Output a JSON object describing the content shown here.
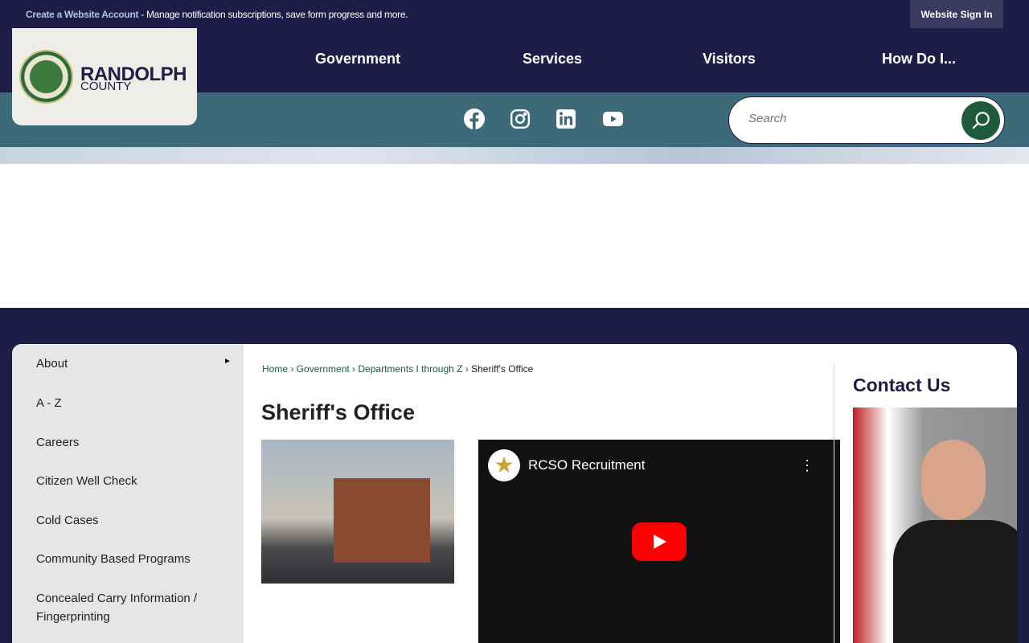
{
  "topbar": {
    "account_link": "Create a Website Account",
    "account_msg": " - Manage notification subscriptions, save form progress and more.",
    "signin": "Website Sign In"
  },
  "logo": {
    "name": "RANDOLPH",
    "sub": "COUNTY"
  },
  "nav": [
    "Government",
    "Services",
    "Visitors",
    "How Do I..."
  ],
  "social": [
    "facebook-icon",
    "instagram-icon",
    "linkedin-icon",
    "youtube-icon"
  ],
  "search": {
    "placeholder": "Search"
  },
  "sidebar": [
    {
      "label": "About",
      "has_submenu": true
    },
    {
      "label": "A - Z"
    },
    {
      "label": "Careers"
    },
    {
      "label": "Citizen Well Check"
    },
    {
      "label": "Cold Cases"
    },
    {
      "label": "Community Based Programs"
    },
    {
      "label": "Concealed Carry Information / Fingerprinting"
    }
  ],
  "breadcrumb": [
    "Home",
    "Government",
    "Departments I through Z",
    "Sheriff's Office"
  ],
  "page_title": "Sheriff's Office",
  "video": {
    "title": "RCSO Recruitment"
  },
  "contact": {
    "title": "Contact Us"
  },
  "colors": {
    "navy": "#1e1c48",
    "teal": "#3d6a78",
    "green": "#1f5a3a"
  }
}
